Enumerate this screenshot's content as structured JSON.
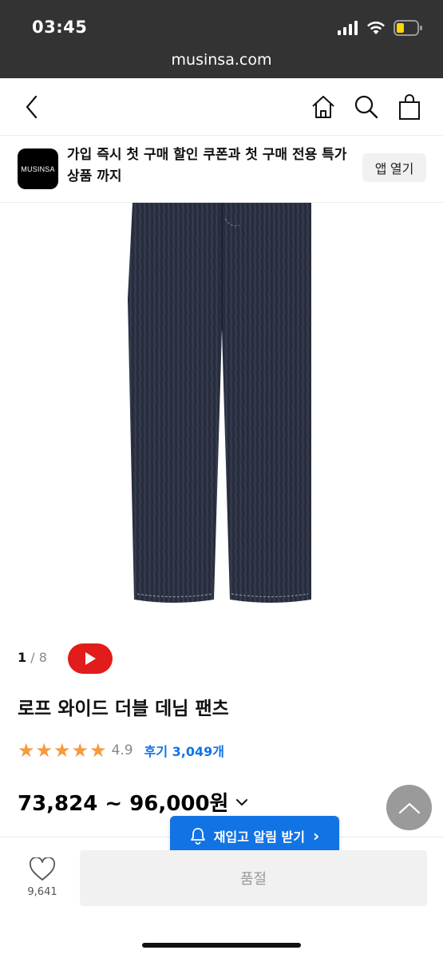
{
  "status_bar": {
    "time": "03:45",
    "url": "musinsa.com"
  },
  "nav": {
    "back_icon": "chevron-left-icon",
    "home_icon": "home-icon",
    "search_icon": "search-icon",
    "bag_icon": "shopping-bag-icon"
  },
  "banner": {
    "logo_text": "MUSINSA",
    "message": "가입 즉시 첫 구매 할인 쿠폰과 첫 구매 전용 특가 상품 까지",
    "open_label": "앱 열기"
  },
  "gallery": {
    "current": "1",
    "total": "/ 8"
  },
  "product": {
    "title": "로프 와이드 더블 데님 팬츠",
    "rating": "4.9",
    "star_count": 5,
    "reviews": "후기 3,049개",
    "price": "73,824 ~ 96,000원"
  },
  "restock": {
    "label": "재입고 알림 받기",
    "arrow": "›"
  },
  "bottom": {
    "like_count": "9,641",
    "soldout_label": "품절"
  },
  "colors": {
    "status_bg": "#333333",
    "accent_blue": "#1273e4",
    "star_orange": "#f59a3d",
    "youtube_red": "#e21b1b",
    "denim": "#2b3142"
  }
}
